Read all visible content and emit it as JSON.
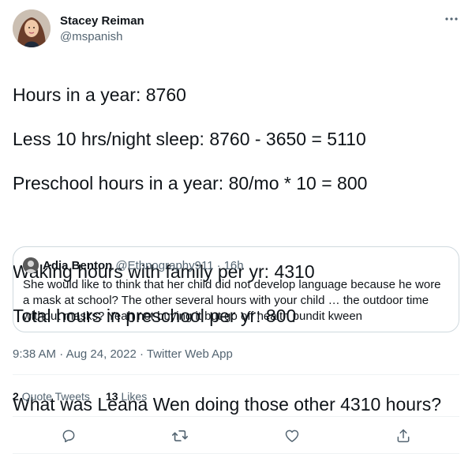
{
  "author": {
    "display_name": "Stacey Reiman",
    "handle": "@mspanish",
    "avatar_icon": "user-avatar-photo"
  },
  "more_icon": "more-horizontal-icon",
  "tweet": {
    "lines": [
      "Hours in a year:  8760",
      "Less 10 hrs/night sleep: 8760 - 3650 = 5110",
      "Preschool hours in a year: 80/mo * 10 = 800",
      "",
      "Waking hours with family per yr:  4310",
      "Total hours in preschool per yr: 800",
      "",
      "What was Leana Wen doing those other 4310 hours?"
    ]
  },
  "quote": {
    "display_name": "Adia Benton",
    "handle": "@Ethnography911",
    "separator": "·",
    "time": "16h",
    "text": "She would like to think that her child did not develop language because he wore a mask at school? The other several hours with your child … the outdoor time without masks? Yeah not buying it but go off health pundit kween"
  },
  "meta": {
    "time": "9:38 AM",
    "separator": "·",
    "date": "Aug 24, 2022",
    "client": "Twitter Web App"
  },
  "stats": {
    "quote_tweets_count": "2",
    "quote_tweets_label": "Quote Tweets",
    "likes_count": "13",
    "likes_label": "Likes"
  },
  "actions": {
    "reply_icon": "reply-icon",
    "retweet_icon": "retweet-icon",
    "like_icon": "like-icon",
    "share_icon": "share-icon"
  },
  "colors": {
    "text": "#0f1419",
    "secondary": "#536471",
    "border": "#cfd9de",
    "divider": "#eff3f4"
  }
}
